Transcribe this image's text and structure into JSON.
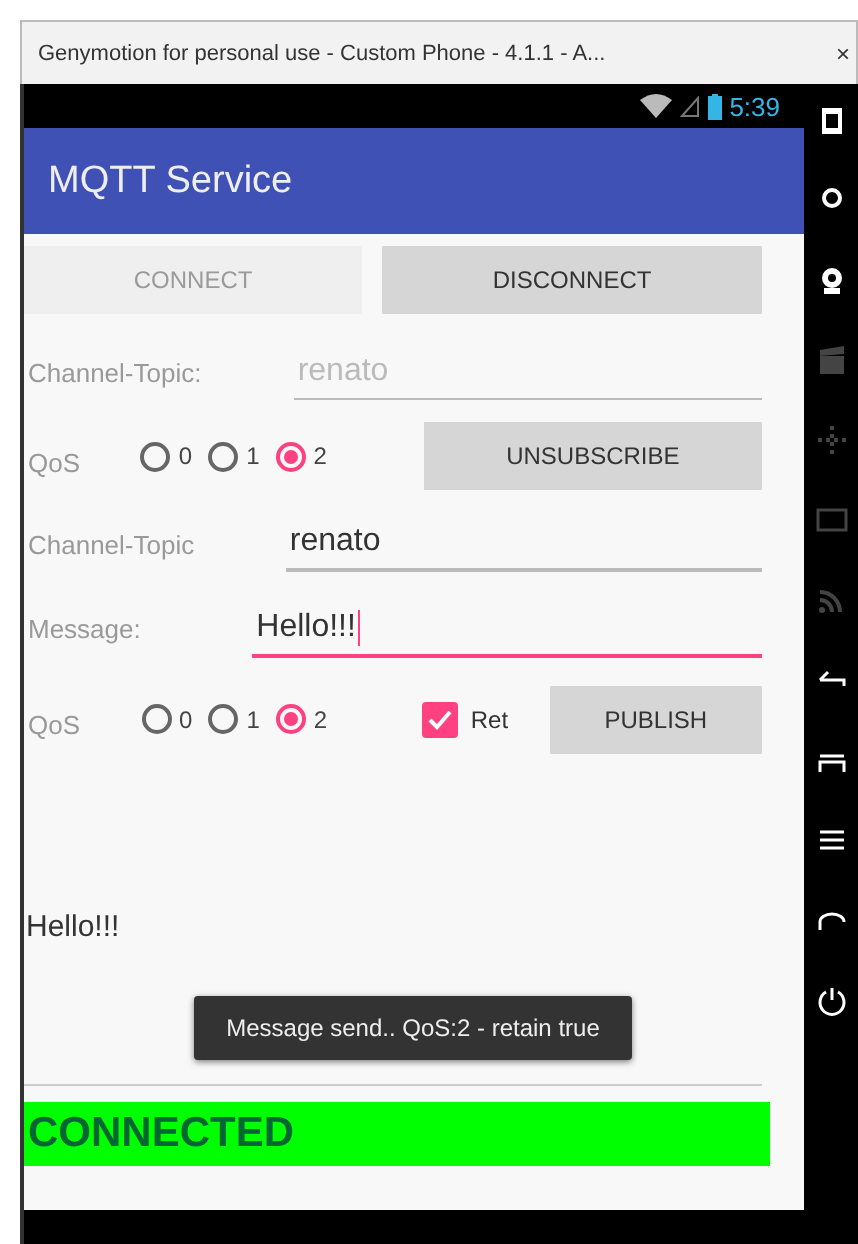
{
  "window": {
    "title": "Genymotion for personal use - Custom Phone - 4.1.1 - A...",
    "close": "×"
  },
  "status_bar": {
    "time": "5:39"
  },
  "app_bar": {
    "title": "MQTT Service"
  },
  "connection_buttons": [
    {
      "label": "CONNECT",
      "disabled": true
    },
    {
      "label": "DISCONNECT",
      "disabled": false
    }
  ],
  "subscribe": {
    "topic_label": "Channel-Topic:",
    "topic_value": "renato",
    "topic_disabled": true,
    "qos_label": "QoS",
    "qos_options": [
      {
        "label": "0",
        "selected": false
      },
      {
        "label": "1",
        "selected": false
      },
      {
        "label": "2",
        "selected": true
      }
    ],
    "button": "UNSUBSCRIBE"
  },
  "publish": {
    "topic_label": "Channel-Topic",
    "topic_value": "renato",
    "message_label": "Message:",
    "message_value": "Hello!!!",
    "message_focused": true,
    "qos_label": "QoS",
    "qos_options": [
      {
        "label": "0",
        "selected": false
      },
      {
        "label": "1",
        "selected": false
      },
      {
        "label": "2",
        "selected": true
      }
    ],
    "retain": {
      "label": "Ret",
      "checked": true
    },
    "button": "PUBLISH"
  },
  "received_message": "Hello!!!",
  "toast": "Message send.. QoS:2 - retain true",
  "connection_status": "CONNECTED"
}
